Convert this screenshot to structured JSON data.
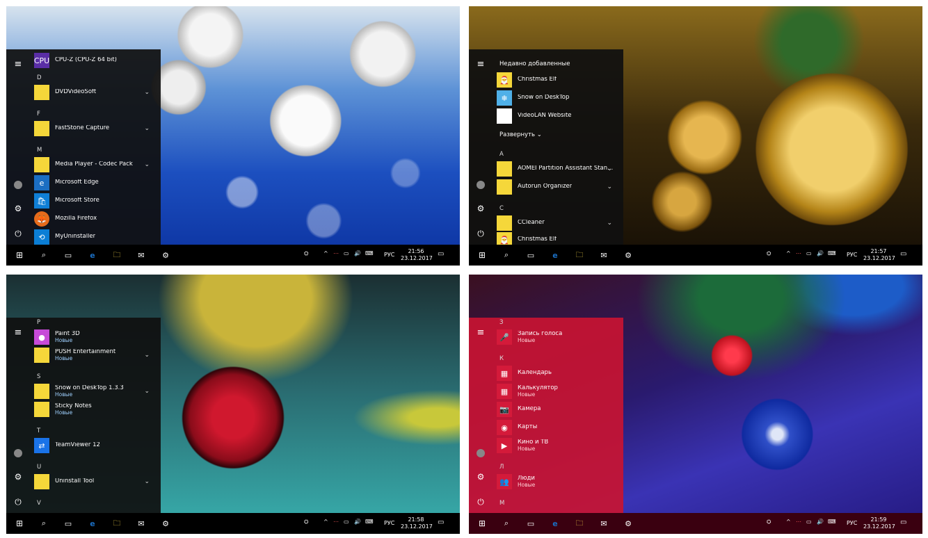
{
  "screens": [
    {
      "id": "s1",
      "list": [
        {
          "type": "app",
          "tile": "purple",
          "icon": "CPU",
          "label": "CPU-Z (CPU-Z 64 bit)"
        },
        {
          "type": "letter",
          "label": "D"
        },
        {
          "type": "app",
          "tile": "yellow",
          "label": "DVDVideoSoft",
          "chevron": true
        },
        {
          "type": "letter",
          "label": "F"
        },
        {
          "type": "app",
          "tile": "yellow",
          "label": "FastStone Capture",
          "chevron": true
        },
        {
          "type": "letter",
          "label": "M"
        },
        {
          "type": "app",
          "tile": "yellow",
          "label": "Media Player - Codec Pack",
          "chevron": true
        },
        {
          "type": "app",
          "tile": "edge",
          "icon": "e",
          "label": "Microsoft Edge"
        },
        {
          "type": "app",
          "tile": "store",
          "icon": "🛍",
          "label": "Microsoft Store"
        },
        {
          "type": "app",
          "tile": "firefox",
          "icon": "🦊",
          "label": "Mozilla Firefox"
        },
        {
          "type": "app",
          "tile": "teal",
          "icon": "⟲",
          "label": "MyUninstaller"
        }
      ],
      "taskbar": {
        "time": "21:56",
        "date": "23.12.2017",
        "lang": "РУС"
      }
    },
    {
      "id": "s2",
      "list": [
        {
          "type": "section",
          "label": "Недавно добавленные"
        },
        {
          "type": "app",
          "tile": "yellow",
          "icon": "🎅",
          "label": "Christmas Elf"
        },
        {
          "type": "app",
          "tile": "yellow",
          "icon": "❄",
          "label": "Snow on DeskTop"
        },
        {
          "type": "app",
          "tile": "white",
          "label": "VideoLAN Website"
        },
        {
          "type": "expand",
          "label": "Развернуть"
        },
        {
          "type": "letter",
          "label": "A"
        },
        {
          "type": "app",
          "tile": "yellow",
          "label": "AOMEI Partition Assistant Stan...",
          "chevron": true
        },
        {
          "type": "app",
          "tile": "yellow",
          "label": "Autorun Organizer",
          "chevron": true
        },
        {
          "type": "letter",
          "label": "C"
        },
        {
          "type": "app",
          "tile": "yellow",
          "label": "CCleaner",
          "chevron": true
        },
        {
          "type": "app",
          "tile": "yellow",
          "icon": "🎅",
          "label": "Christmas Elf"
        }
      ],
      "taskbar": {
        "time": "21:57",
        "date": "23.12.2017",
        "lang": "РУС"
      }
    },
    {
      "id": "s3",
      "list": [
        {
          "type": "letter",
          "label": "P"
        },
        {
          "type": "app",
          "tile": "paint",
          "icon": "●",
          "label": "Paint 3D",
          "sub": "Новые"
        },
        {
          "type": "app",
          "tile": "yellow",
          "label": "PUSH Entertainment",
          "sub": "Новые",
          "chevron": true
        },
        {
          "type": "letter",
          "label": "S"
        },
        {
          "type": "app",
          "tile": "yellow",
          "label": "Snow on DeskTop 1.3.3",
          "sub": "Новые",
          "chevron": true
        },
        {
          "type": "app",
          "tile": "yellow",
          "label": "Sticky Notes",
          "sub": "Новые"
        },
        {
          "type": "letter",
          "label": "T"
        },
        {
          "type": "app",
          "tile": "tv",
          "icon": "⇄",
          "label": "TeamViewer 12"
        },
        {
          "type": "letter",
          "label": "U"
        },
        {
          "type": "app",
          "tile": "yellow",
          "label": "Uninstall Tool",
          "chevron": true
        },
        {
          "type": "letter",
          "label": "V"
        }
      ],
      "taskbar": {
        "time": "21:58",
        "date": "23.12.2017",
        "lang": "РУС"
      }
    },
    {
      "id": "s4",
      "list": [
        {
          "type": "letter",
          "label": "З"
        },
        {
          "type": "app",
          "tile": "red",
          "icon": "🎤",
          "label": "Запись голоса",
          "sub": "Новые"
        },
        {
          "type": "letter",
          "label": "К"
        },
        {
          "type": "app",
          "tile": "red",
          "icon": "▦",
          "label": "Календарь"
        },
        {
          "type": "app",
          "tile": "red",
          "icon": "▦",
          "label": "Калькулятор",
          "sub": "Новые"
        },
        {
          "type": "app",
          "tile": "red",
          "icon": "📷",
          "label": "Камера"
        },
        {
          "type": "app",
          "tile": "red",
          "icon": "◉",
          "label": "Карты"
        },
        {
          "type": "app",
          "tile": "red",
          "icon": "▶",
          "label": "Кино и ТВ",
          "sub": "Новые"
        },
        {
          "type": "letter",
          "label": "Л"
        },
        {
          "type": "app",
          "tile": "red",
          "icon": "👥",
          "label": "Люди",
          "sub": "Новые"
        },
        {
          "type": "letter",
          "label": "М"
        }
      ],
      "taskbar": {
        "time": "21:59",
        "date": "23.12.2017",
        "lang": "РУС"
      }
    }
  ],
  "icons": {
    "start": "⊞",
    "search": "⌕",
    "task": "▭",
    "edge": "e",
    "files": "🗀",
    "mail": "✉",
    "settings": "⚙",
    "people": "⛭",
    "caret": "^",
    "net": "⋯",
    "monitor": "▭",
    "vol": "🔊",
    "kb": "⌨",
    "notify": "▭",
    "menu": "≡",
    "user": "●",
    "gear": "⚙",
    "power": "⏻",
    "chev": "⌄"
  }
}
